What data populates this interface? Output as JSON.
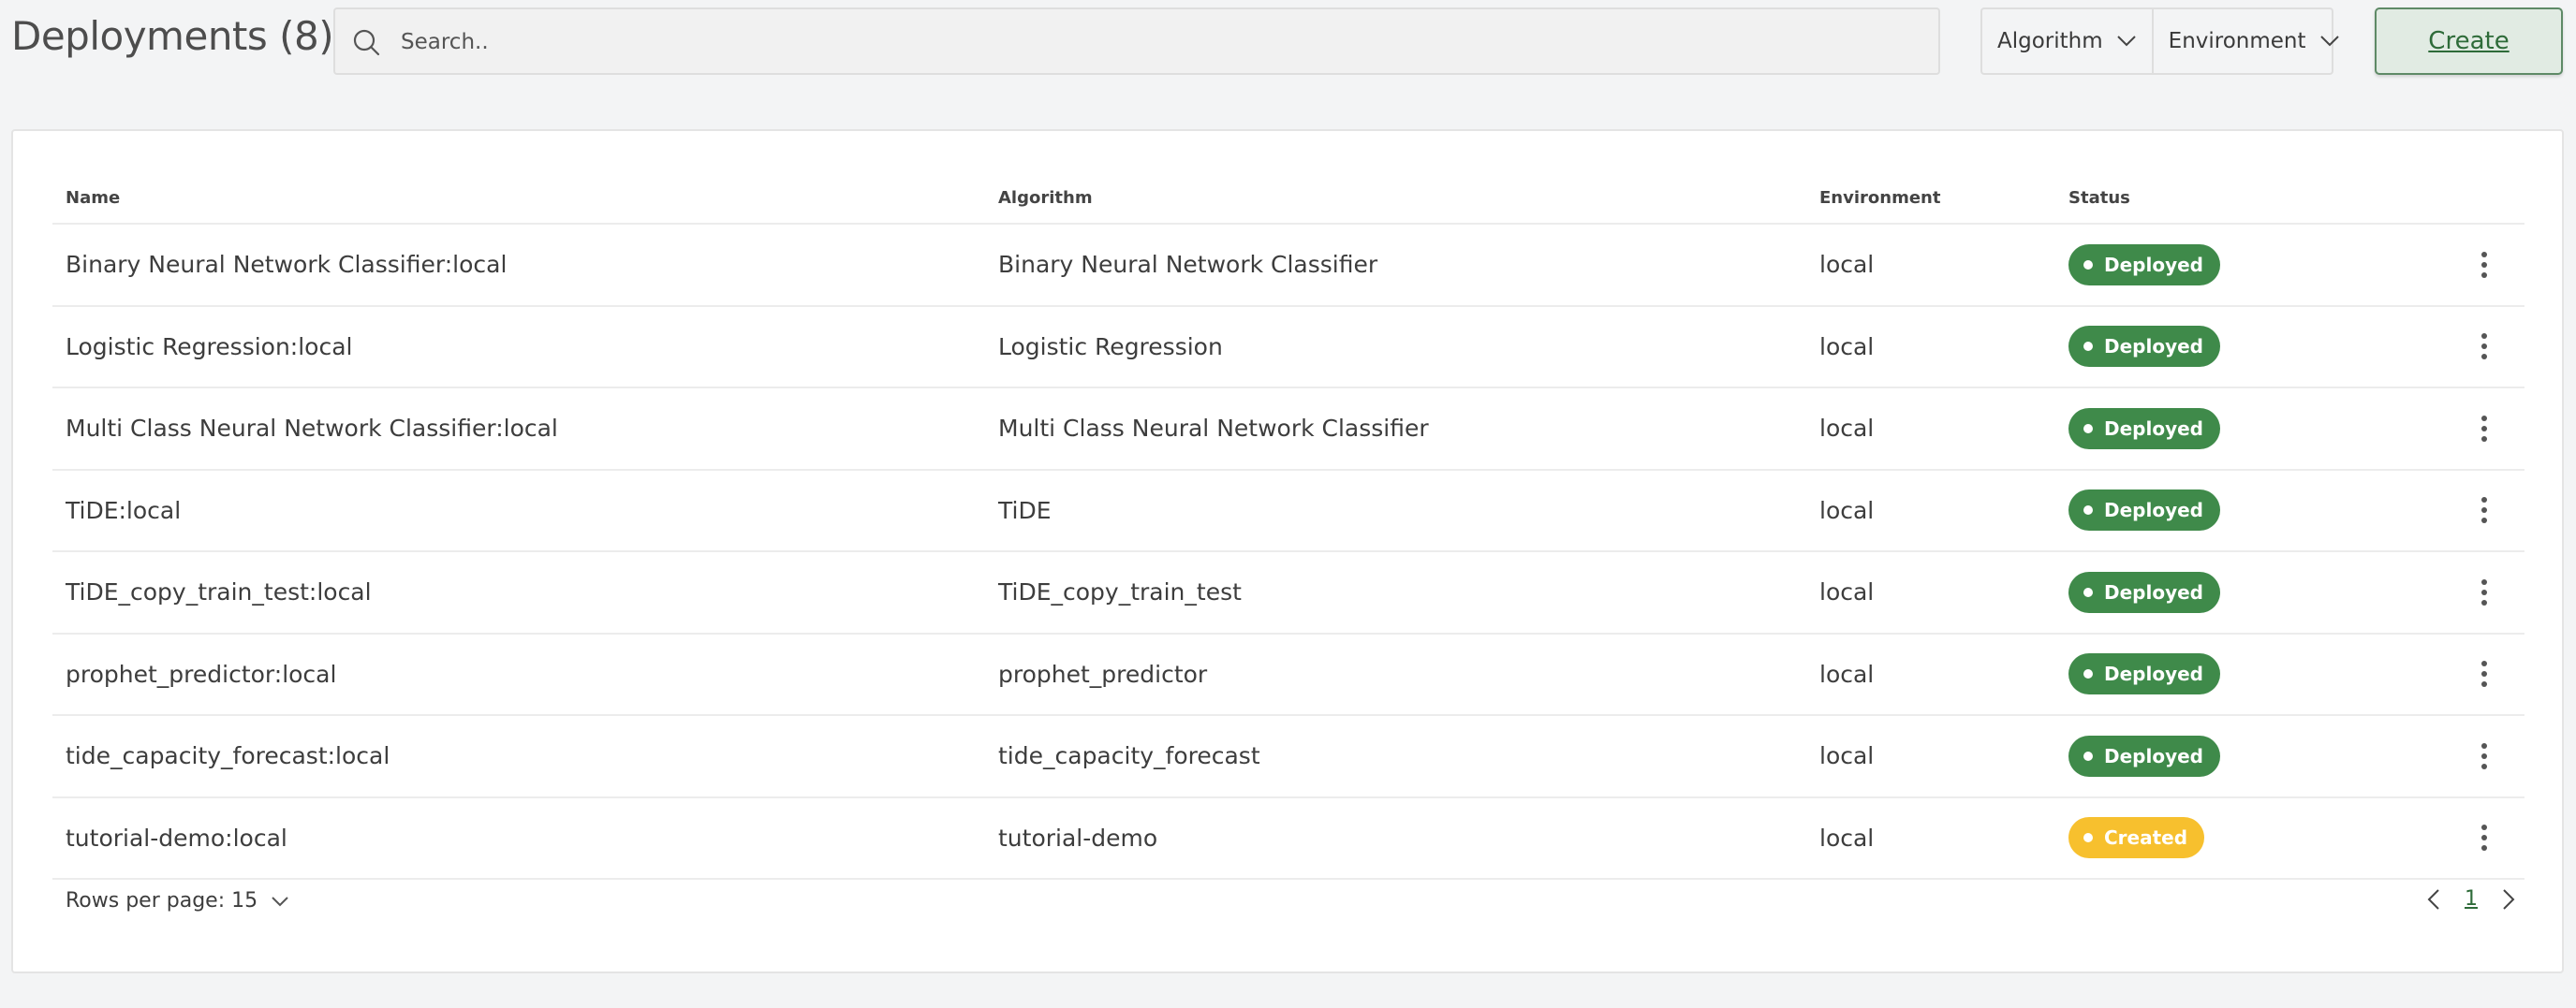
{
  "header": {
    "title": "Deployments (8)",
    "search_placeholder": "Search..",
    "filters": [
      {
        "label": "Algorithm"
      },
      {
        "label": "Environment"
      }
    ],
    "create_label": "Create"
  },
  "table": {
    "columns": {
      "name": "Name",
      "algorithm": "Algorithm",
      "environment": "Environment",
      "status": "Status"
    },
    "rows": [
      {
        "name": "Binary Neural Network Classifier:local",
        "algorithm": "Binary Neural Network Classifier",
        "environment": "local",
        "status": "Deployed"
      },
      {
        "name": "Logistic Regression:local",
        "algorithm": "Logistic Regression",
        "environment": "local",
        "status": "Deployed"
      },
      {
        "name": "Multi Class Neural Network Classifier:local",
        "algorithm": "Multi Class Neural Network Classifier",
        "environment": "local",
        "status": "Deployed"
      },
      {
        "name": "TiDE:local",
        "algorithm": "TiDE",
        "environment": "local",
        "status": "Deployed"
      },
      {
        "name": "TiDE_copy_train_test:local",
        "algorithm": "TiDE_copy_train_test",
        "environment": "local",
        "status": "Deployed"
      },
      {
        "name": "prophet_predictor:local",
        "algorithm": "prophet_predictor",
        "environment": "local",
        "status": "Deployed"
      },
      {
        "name": "tide_capacity_forecast:local",
        "algorithm": "tide_capacity_forecast",
        "environment": "local",
        "status": "Deployed"
      },
      {
        "name": "tutorial-demo:local",
        "algorithm": "tutorial-demo",
        "environment": "local",
        "status": "Created"
      }
    ]
  },
  "footer": {
    "rows_per_page_label": "Rows per page: 15",
    "current_page": "1"
  },
  "colors": {
    "deployed": "#3f8a4a",
    "created": "#f7c02e",
    "accent": "#2e6b39"
  },
  "icons": {
    "search": "search-icon",
    "dropdown": "chevron-down-icon",
    "row_menu": "kebab-menu-icon",
    "prev": "chevron-left-icon",
    "next": "chevron-right-icon"
  }
}
